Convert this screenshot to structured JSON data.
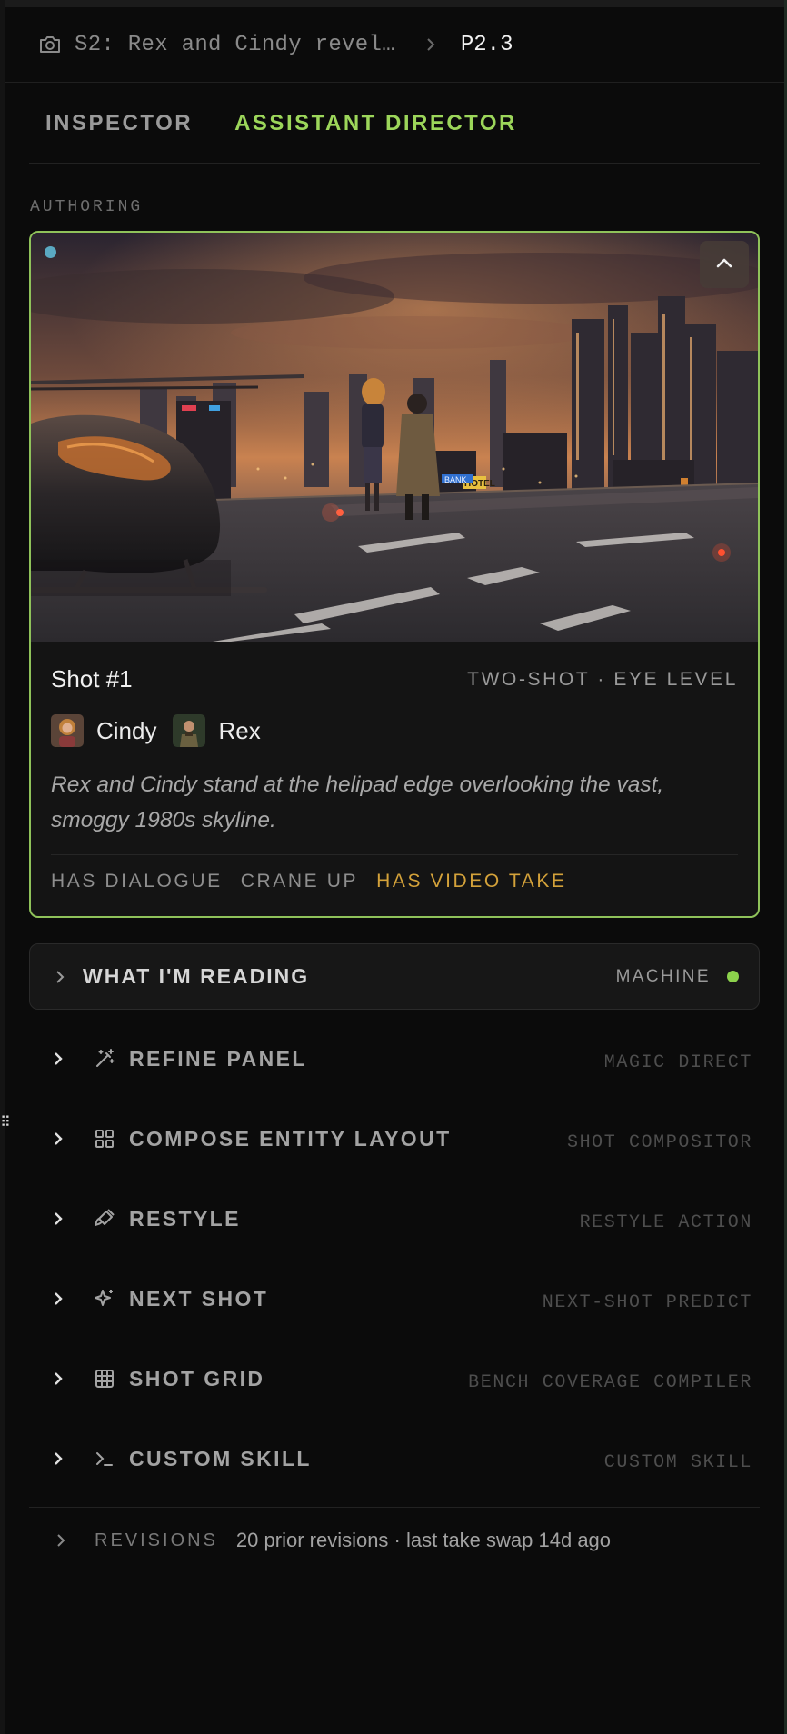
{
  "breadcrumb": {
    "camera_icon": "camera-icon",
    "scene_label": "S2: Rex and Cindy revel…",
    "separator_icon": "chevron-right-icon",
    "shot_id": "P2.3"
  },
  "tabs": [
    {
      "label": "INSPECTOR",
      "active": false
    },
    {
      "label": "ASSISTANT DIRECTOR",
      "active": true
    }
  ],
  "section_label": "AUTHORING",
  "shot_card": {
    "title": "Shot #1",
    "meta": "TWO-SHOT · EYE LEVEL",
    "characters": [
      {
        "name": "Cindy",
        "avatar_icon": "cindy-avatar"
      },
      {
        "name": "Rex",
        "avatar_icon": "rex-avatar"
      }
    ],
    "logline": "Rex and Cindy stand at the helipad edge overlooking the vast, smoggy 1980s skyline.",
    "tags": [
      {
        "label": "HAS DIALOGUE",
        "highlight": false
      },
      {
        "label": "CRANE UP",
        "highlight": false
      },
      {
        "label": "HAS VIDEO TAKE",
        "highlight": true
      }
    ],
    "collapse_icon": "chevron-up-icon",
    "accent_border": "#8fc25a",
    "status_dot_color": "#5aa9c2",
    "image_signs": [
      "BANK",
      "HOTEL"
    ]
  },
  "reading": {
    "label": "WHAT I'M READING",
    "source": "MACHINE",
    "status_color": "#8cd24c"
  },
  "skills": [
    {
      "label": "REFINE PANEL",
      "icon": "magic-wand-icon",
      "source": "MAGIC DIRECT"
    },
    {
      "label": "COMPOSE ENTITY LAYOUT",
      "icon": "layout-grid-icon",
      "source": "SHOT COMPOSITOR"
    },
    {
      "label": "RESTYLE",
      "icon": "paintbrush-icon",
      "source": "RESTYLE ACTION"
    },
    {
      "label": "NEXT SHOT",
      "icon": "sparkles-icon",
      "source": "NEXT-SHOT PREDICT"
    },
    {
      "label": "SHOT GRID",
      "icon": "grid-icon",
      "source": "BENCH COVERAGE COMPILER"
    },
    {
      "label": "CUSTOM SKILL",
      "icon": "terminal-icon",
      "source": "CUSTOM SKILL"
    }
  ],
  "revisions": {
    "label": "REVISIONS",
    "info": "20 prior revisions · last take swap 14d ago"
  },
  "colors": {
    "accent_green": "#9cd65a",
    "highlight_gold": "#d4a23a",
    "background": "#0b0b0b"
  }
}
